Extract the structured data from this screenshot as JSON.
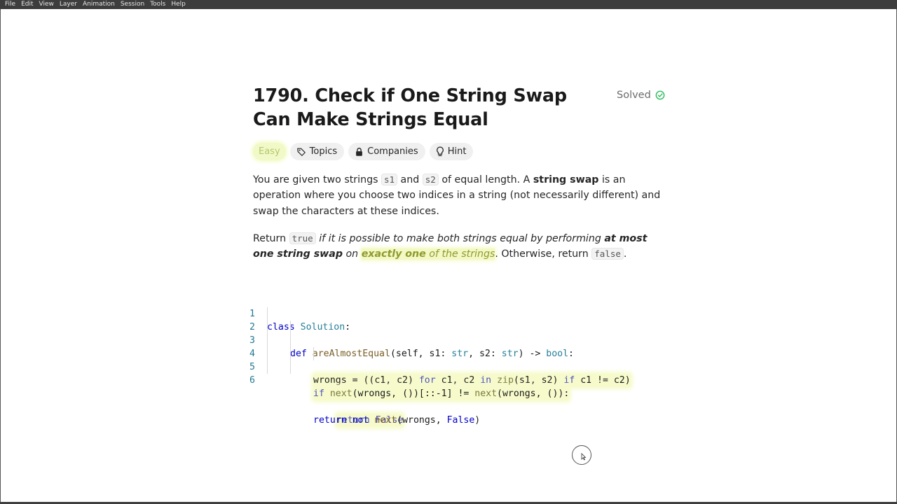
{
  "menubar": {
    "items": [
      "File",
      "Edit",
      "View",
      "Layer",
      "Animation",
      "Session",
      "Tools",
      "Help"
    ]
  },
  "problem": {
    "title": "1790. Check if One String Swap Can Make Strings Equal",
    "status": "Solved",
    "status_color": "#2cbb5d",
    "tags": {
      "difficulty": "Easy",
      "topics": "Topics",
      "companies": "Companies",
      "hint": "Hint"
    },
    "description": {
      "p1": {
        "t1": "You are given two strings ",
        "c1": "s1",
        "t2": " and ",
        "c2": "s2",
        "t3": " of equal length. A ",
        "b1": "string swap",
        "t4": " is an operation where you choose two indices in a string (not necessarily different) and swap the characters at these indices."
      },
      "p2": {
        "t1": "Return ",
        "c1": "true",
        "i1": " if it is possible to make both strings equal by performing ",
        "b1": "at most one string swap",
        "i2": " on ",
        "b2": "exactly one",
        "i3": " of the strings",
        "t2": ". Otherwise, return ",
        "c2": "false",
        "t3": "."
      }
    }
  },
  "code": {
    "line_numbers": [
      "1",
      "2",
      "3",
      "4",
      "5",
      "6"
    ],
    "l1": {
      "kw": "class",
      "name": "Solution",
      "colon": ":"
    },
    "l2": {
      "kw": "def",
      "fn": "areAlmostEqual",
      "p1": "(self, s1: ",
      "t1": "str",
      "p2": ", s2: ",
      "t2": "str",
      "p3": ") -> ",
      "t3": "bool",
      "p4": ":"
    },
    "l3": {
      "a": "wrongs = ((c1, c2) ",
      "kw1": "for",
      "b": " c1, c2 ",
      "kw2": "in",
      "sp": " ",
      "fn": "zip",
      "c": "(s1, s2) ",
      "kw3": "if",
      "d": " c1 != c2)"
    },
    "l4": {
      "kw": "if",
      "sp": " ",
      "fn1": "next",
      "a": "(wrongs, ())[::-1] != ",
      "fn2": "next",
      "b": "(wrongs, ()):"
    },
    "l5": {
      "kw": "return",
      "val": " False"
    },
    "l6": {
      "kw1": "return",
      "kw2": " not",
      "sp": " ",
      "fn": "next",
      "a": "(wrongs, ",
      "val": "False",
      "b": ")"
    }
  }
}
